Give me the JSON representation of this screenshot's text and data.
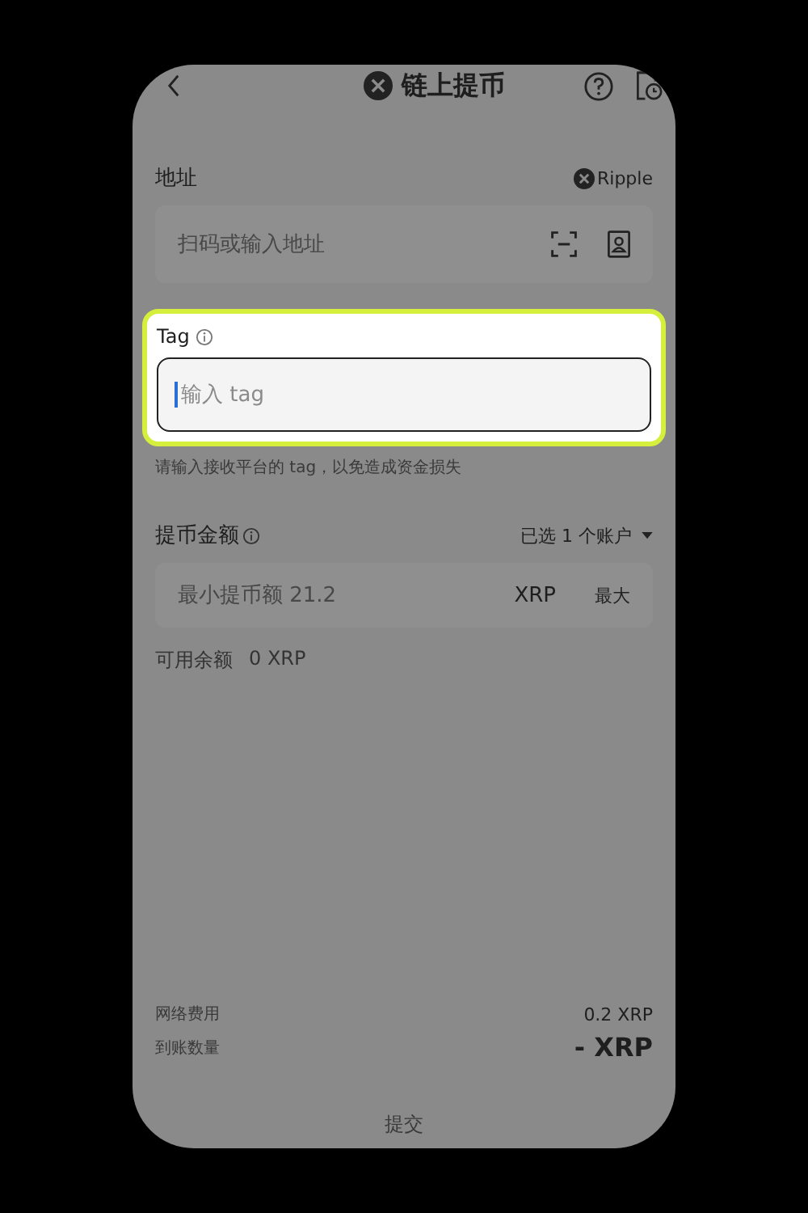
{
  "header": {
    "title": "链上提币"
  },
  "address": {
    "label": "地址",
    "network": "Ripple",
    "placeholder": "扫码或输入地址"
  },
  "tag": {
    "label": "Tag",
    "placeholder": "输入 tag",
    "highlighted": true,
    "hint": "请输入接收平台的 tag，以免造成资金损失"
  },
  "amount": {
    "label": "提币金额",
    "account_selector": "已选 1 个账户",
    "placeholder": "最小提币额 21.2",
    "unit": "XRP",
    "max_button": "最大"
  },
  "available": {
    "label": "可用余额",
    "value": "0 XRP"
  },
  "summary": [
    {
      "label": "网络费用",
      "value": "0.2 XRP",
      "kind": "normal"
    },
    {
      "label": "到账数量",
      "value": "- XRP",
      "kind": "emphasis"
    }
  ],
  "submit": "提交"
}
